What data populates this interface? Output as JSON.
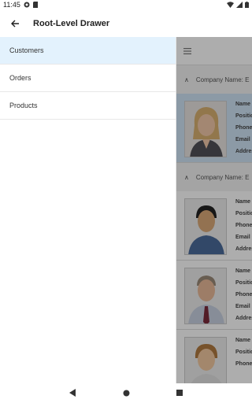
{
  "status": {
    "time": "11:45"
  },
  "app_bar": {
    "title": "Root-Level Drawer"
  },
  "drawer": {
    "items": [
      {
        "label": "Customers"
      },
      {
        "label": "Orders"
      },
      {
        "label": "Products"
      }
    ]
  },
  "content": {
    "groups": [
      {
        "header": "Company Name: E"
      },
      {
        "header": "Company Name: E"
      }
    ],
    "field_labels": [
      "Name",
      "Position",
      "Phone",
      "Email",
      "Address"
    ]
  }
}
